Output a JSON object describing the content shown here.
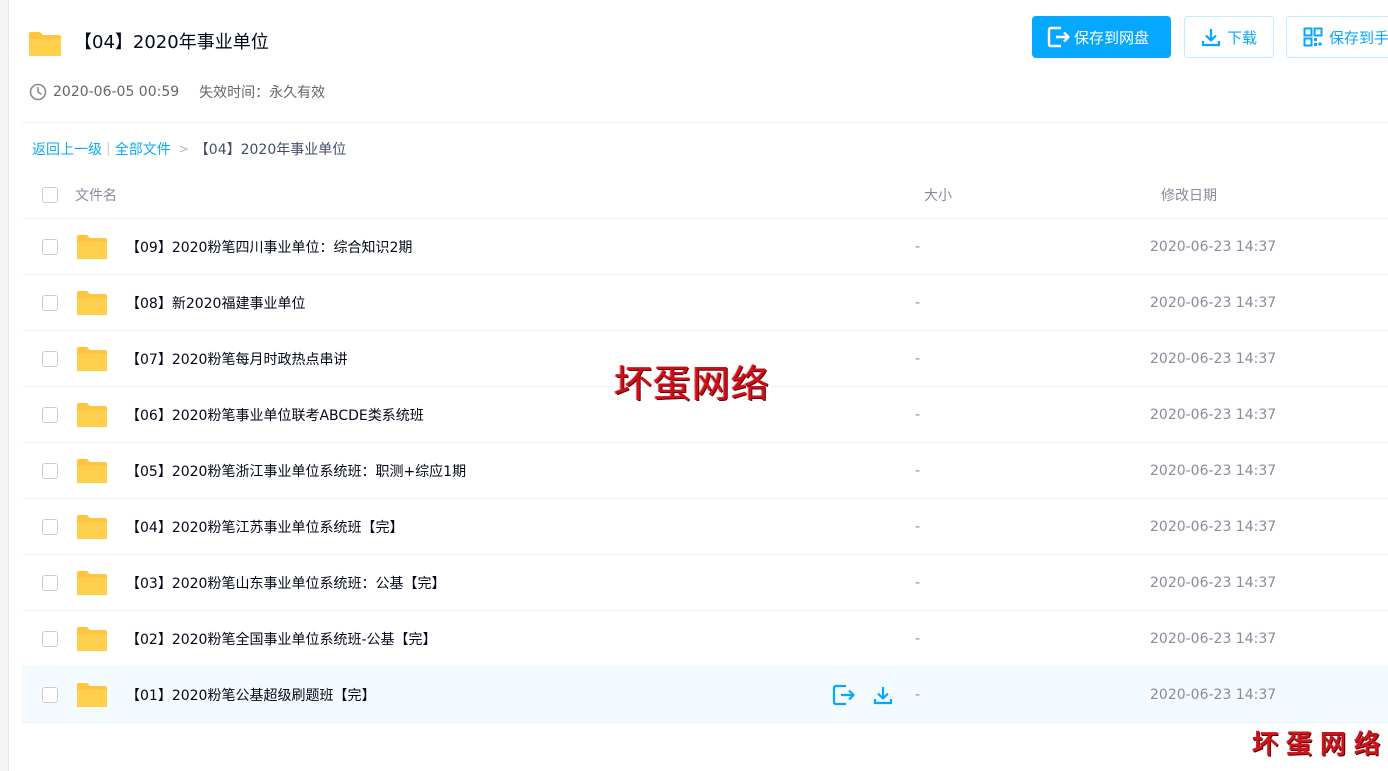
{
  "share": {
    "title": "【04】2020年事业单位",
    "created_at": "2020-06-05 00:59",
    "expire_label": "失效时间：永久有效"
  },
  "toolbar": {
    "save_label": "保存到网盘",
    "download_label": "下载",
    "save_to_phone_label": "保存到手"
  },
  "breadcrumb": {
    "back_label": "返回上一级",
    "separator": "|",
    "all_files_label": "全部文件",
    "arrow": ">",
    "current": "【04】2020年事业单位"
  },
  "table": {
    "headers": {
      "name": "文件名",
      "size": "大小",
      "date": "修改日期"
    },
    "rows": [
      {
        "name": "【09】2020粉笔四川事业单位：综合知识2期",
        "size": "-",
        "date": "2020-06-23 14:37"
      },
      {
        "name": "【08】新2020福建事业单位",
        "size": "-",
        "date": "2020-06-23 14:37"
      },
      {
        "name": "【07】2020粉笔每月时政热点串讲",
        "size": "-",
        "date": "2020-06-23 14:37"
      },
      {
        "name": "【06】2020粉笔事业单位联考ABCDE类系统班",
        "size": "-",
        "date": "2020-06-23 14:37"
      },
      {
        "name": "【05】2020粉笔浙江事业单位系统班：职测+综应1期",
        "size": "-",
        "date": "2020-06-23 14:37"
      },
      {
        "name": "【04】2020粉笔江苏事业单位系统班【完】",
        "size": "-",
        "date": "2020-06-23 14:37"
      },
      {
        "name": "【03】2020粉笔山东事业单位系统班：公基【完】",
        "size": "-",
        "date": "2020-06-23 14:37"
      },
      {
        "name": "【02】2020粉笔全国事业单位系统班-公基【完】",
        "size": "-",
        "date": "2020-06-23 14:37"
      },
      {
        "name": "【01】2020粉笔公基超级刷题班【完】",
        "size": "-",
        "date": "2020-06-23 14:37"
      }
    ]
  },
  "watermark": {
    "main": "坏蛋网络",
    "corner": "坏蛋网络"
  },
  "colors": {
    "accent": "#06a7ff",
    "link": "#09aaff",
    "folder": "#ffd04b",
    "watermark": "#c8101c"
  },
  "icons": {
    "folder": "folder-icon",
    "clock": "clock-icon",
    "save": "save-to-cloud-icon",
    "download": "download-icon",
    "qr": "qr-code-icon"
  }
}
